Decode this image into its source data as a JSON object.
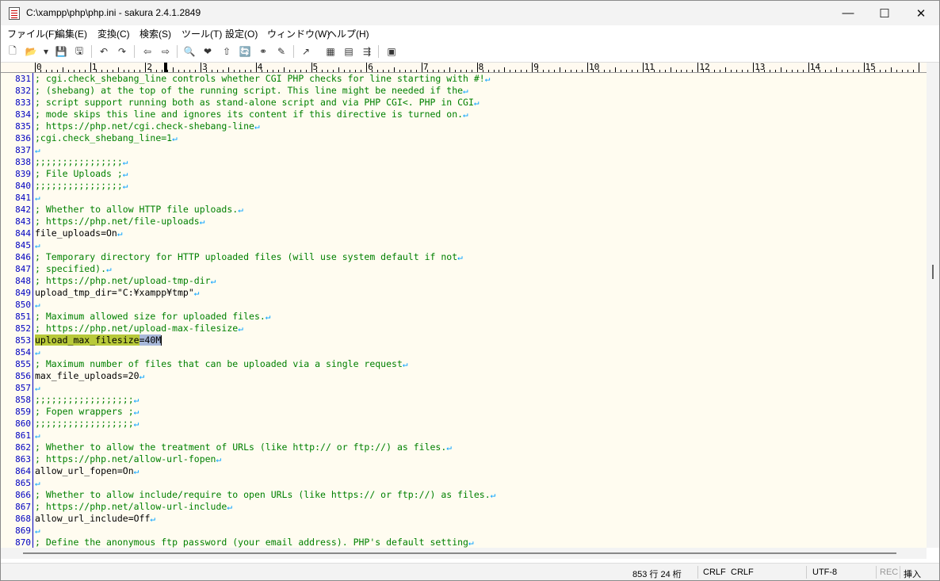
{
  "window": {
    "title": "C:\\xampp\\php\\php.ini - sakura 2.4.1.2849",
    "minimize": "—",
    "maximize": "☐",
    "close": "✕"
  },
  "menu": [
    "ファイル(F)",
    "編集(E)",
    "変換(C)",
    "検索(S)",
    "ツール(T)",
    "設定(O)",
    "ウィンドウ(W)",
    "ヘルプ(H)"
  ],
  "toolbar": {
    "icons": [
      "new-file-icon",
      "open-file-icon",
      "dropdown-icon",
      "save-icon",
      "save-all-icon",
      "undo-icon",
      "redo-icon",
      "jump-prev-icon",
      "jump-next-icon",
      "search-icon",
      "search-prev-icon",
      "search-next-icon",
      "replace-icon",
      "find-all-icon",
      "highlight-icon",
      "tag-jump-icon",
      "outline-icon",
      "compare-icon",
      "grep-icon",
      "settings-icon"
    ],
    "glyphs": [
      "🗋",
      "📂",
      "▾",
      "💾",
      "🖫",
      "↶",
      "↷",
      "⇦",
      "⇨",
      "🔍",
      "❤",
      "⇧",
      "🔄",
      "⚭",
      "✎",
      "↗",
      "▦",
      "▤",
      "⇶",
      "▣"
    ]
  },
  "ruler": {
    "labels": [
      "0",
      "1",
      "2",
      "3",
      "4",
      "5",
      "6",
      "7",
      "8",
      "9",
      "10",
      "11",
      "12",
      "13",
      "14",
      "15"
    ]
  },
  "editor": {
    "newline_glyph": "↵",
    "lines": [
      {
        "n": "831",
        "t": "; cgi.check_shebang_line controls whether CGI PHP checks for line starting with #!",
        "c": true
      },
      {
        "n": "832",
        "t": "; (shebang) at the top of the running script. This line might be needed if the",
        "c": true
      },
      {
        "n": "833",
        "t": "; script support running both as stand-alone script and via PHP CGI<. PHP in CGI",
        "c": true
      },
      {
        "n": "834",
        "t": "; mode skips this line and ignores its content if this directive is turned on.",
        "c": true
      },
      {
        "n": "835",
        "t": "; https://php.net/cgi.check-shebang-line",
        "c": true
      },
      {
        "n": "836",
        "t": ";cgi.check_shebang_line=1",
        "c": true
      },
      {
        "n": "837",
        "t": "",
        "c": false
      },
      {
        "n": "838",
        "t": ";;;;;;;;;;;;;;;;",
        "c": true
      },
      {
        "n": "839",
        "t": "; File Uploads ;",
        "c": true
      },
      {
        "n": "840",
        "t": ";;;;;;;;;;;;;;;;",
        "c": true
      },
      {
        "n": "841",
        "t": "",
        "c": false
      },
      {
        "n": "842",
        "t": "; Whether to allow HTTP file uploads.",
        "c": true
      },
      {
        "n": "843",
        "t": "; https://php.net/file-uploads",
        "c": true
      },
      {
        "n": "844",
        "t": "file_uploads=On",
        "c": false
      },
      {
        "n": "845",
        "t": "",
        "c": false
      },
      {
        "n": "846",
        "t": "; Temporary directory for HTTP uploaded files (will use system default if not",
        "c": true
      },
      {
        "n": "847",
        "t": "; specified).",
        "c": true
      },
      {
        "n": "848",
        "t": "; https://php.net/upload-tmp-dir",
        "c": true
      },
      {
        "n": "849",
        "t": "upload_tmp_dir=\"C:¥xampp¥tmp\"",
        "c": false
      },
      {
        "n": "850",
        "t": "",
        "c": false
      },
      {
        "n": "851",
        "t": "; Maximum allowed size for uploaded files.",
        "c": true
      },
      {
        "n": "852",
        "t": "; https://php.net/upload-max-filesize",
        "c": true
      },
      {
        "n": "853",
        "t": "upload_max_filesize=40M",
        "c": false,
        "hl": true
      },
      {
        "n": "854",
        "t": "",
        "c": false
      },
      {
        "n": "855",
        "t": "; Maximum number of files that can be uploaded via a single request",
        "c": true
      },
      {
        "n": "856",
        "t": "max_file_uploads=20",
        "c": false
      },
      {
        "n": "857",
        "t": "",
        "c": false
      },
      {
        "n": "858",
        "t": ";;;;;;;;;;;;;;;;;;",
        "c": true
      },
      {
        "n": "859",
        "t": "; Fopen wrappers ;",
        "c": true
      },
      {
        "n": "860",
        "t": ";;;;;;;;;;;;;;;;;;",
        "c": true
      },
      {
        "n": "861",
        "t": "",
        "c": false
      },
      {
        "n": "862",
        "t": "; Whether to allow the treatment of URLs (like http:// or ftp://) as files.",
        "c": true
      },
      {
        "n": "863",
        "t": "; https://php.net/allow-url-fopen",
        "c": true
      },
      {
        "n": "864",
        "t": "allow_url_fopen=On",
        "c": false
      },
      {
        "n": "865",
        "t": "",
        "c": false
      },
      {
        "n": "866",
        "t": "; Whether to allow include/require to open URLs (like https:// or ftp://) as files.",
        "c": true
      },
      {
        "n": "867",
        "t": "; https://php.net/allow-url-include",
        "c": true
      },
      {
        "n": "868",
        "t": "allow_url_include=Off",
        "c": false
      },
      {
        "n": "869",
        "t": "",
        "c": false
      },
      {
        "n": "870",
        "t": "; Define the anonymous ftp password (your email address). PHP's default setting",
        "c": true
      }
    ],
    "highlight_line": "853",
    "highlight_key": "upload_max_filesize",
    "highlight_value": "=40M"
  },
  "status": {
    "position": "853 行  24 桁",
    "eol1": "CRLF",
    "eol2": "CRLF",
    "encoding": "UTF-8",
    "rec": "REC",
    "mode": "挿入"
  },
  "colors": {
    "comment": "#008000",
    "line_number": "#0000c0",
    "background": "#fffcf0",
    "newline": "#00a0ff",
    "highlight": "#b8c93a"
  }
}
